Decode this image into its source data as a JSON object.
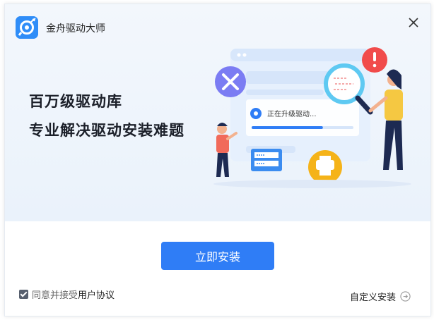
{
  "app": {
    "title": "金舟驱动大师",
    "accent": "#2f7df6"
  },
  "hero": {
    "headline": "百万级驱动库",
    "subline": "专业解决驱动安装难题",
    "status_text": "正在升级驱动...",
    "upgrade_progress": 0.7
  },
  "actions": {
    "install_label": "立即安装",
    "agree_prefix": "同意并接受",
    "agreement_link": "用户协议",
    "agree_checked": true,
    "custom_install": "自定义安装"
  },
  "colors": {
    "brand_blue": "#2f8df8",
    "hero_bg": "#eef4fb",
    "alert_red": "#f14b4b",
    "printer_orange": "#f5b319",
    "tool_purple": "#7b7cf3"
  }
}
